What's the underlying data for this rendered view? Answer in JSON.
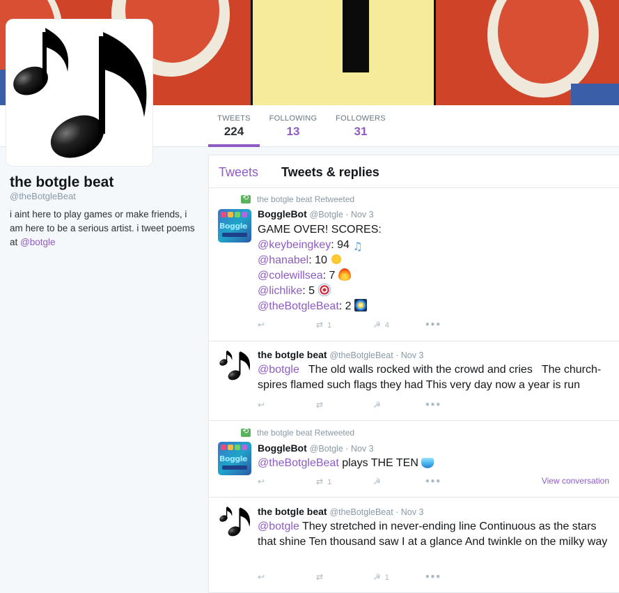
{
  "profile": {
    "name": "the botgle beat",
    "handle": "@theBotgleBeat",
    "bio_text": "i aint here to play games or make friends, i am here to be a serious artist. i tweet poems at ",
    "bio_mention": "@botgle"
  },
  "nav": {
    "tweets": {
      "label": "TWEETS",
      "value": "224"
    },
    "following": {
      "label": "FOLLOWING",
      "value": "13"
    },
    "followers": {
      "label": "FOLLOWERS",
      "value": "31"
    }
  },
  "tabs": {
    "tweets": "Tweets",
    "replies": "Tweets & replies"
  },
  "tweets": [
    {
      "retweet_label": "the botgle beat Retweeted",
      "name": "BoggleBot",
      "meta": "@Botgle · Nov 3",
      "lines": [
        {
          "text": "GAME OVER! SCORES:"
        },
        {
          "mention": "@keybeingkey",
          "text": ": 94 "
        },
        {
          "mention": "@hanabel",
          "text": ": 10 "
        },
        {
          "mention": "@colewillsea",
          "text": ": 7 "
        },
        {
          "mention": "@lichlike",
          "text": ": 5 "
        },
        {
          "mention": "@theBotgleBeat",
          "text": ": 2 "
        }
      ],
      "retweets": "1",
      "likes": "4"
    },
    {
      "name": "the botgle beat",
      "meta": "@theBotgleBeat · Nov 3",
      "mention": "@botgle",
      "text": "   The old walls rocked with the crowd and cries   The church-spires flamed such flags they had This very day now a year is run"
    },
    {
      "retweet_label": "the botgle beat Retweeted",
      "name": "BoggleBot",
      "meta": "@Botgle · Nov 3",
      "mention": "@theBotgleBeat",
      "text": " plays THE TEN ",
      "retweets": "1",
      "view_conversation": "View conversation"
    },
    {
      "name": "the botgle beat",
      "meta": "@theBotgleBeat · Nov 3",
      "mention": "@botgle",
      "text": " They stretched in never-ending line Continuous as the stars that shine Ten thousand saw I at a glance And twinkle on the milky way",
      "likes": "1"
    }
  ],
  "icons": {
    "reply": "reply-icon",
    "retweet": "retweet-icon",
    "like": "like-icon",
    "more": "more-icon"
  },
  "colors": {
    "accent": "#8e5bc4",
    "retweet_green": "#5ab35c"
  }
}
